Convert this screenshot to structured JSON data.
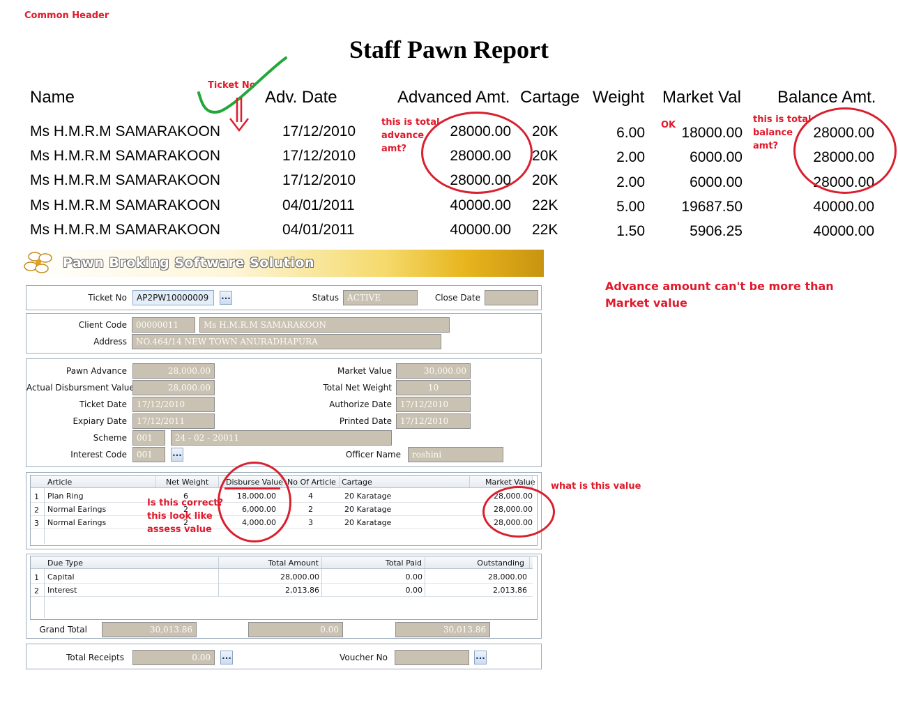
{
  "annotations": {
    "common_header": "Common Header",
    "ticket_no": "Ticket No",
    "total_advance": [
      "this is total",
      "advance",
      "amt?"
    ],
    "ok": "OK",
    "total_balance": [
      "this is total",
      "balance",
      "amt?"
    ],
    "advance_rule": [
      "Advance amount can't  be   more than",
      "Market value"
    ],
    "what_value": "what is this value",
    "assess_note": [
      "Is this correct?",
      "this look like",
      "assess value"
    ]
  },
  "report": {
    "title": "Staff Pawn Report",
    "headers": {
      "name": "Name",
      "adv_date": "Adv. Date",
      "advanced_amt": "Advanced Amt.",
      "cartage": "Cartage",
      "weight": "Weight",
      "market_val": "Market Val",
      "balance_amt": "Balance Amt."
    },
    "rows": [
      {
        "name": "Ms H.M.R.M SAMARAKOON",
        "date": "17/12/2010",
        "advanced": "28000.00",
        "cartage": "20K",
        "weight": "6.00",
        "market": "18000.00",
        "balance": "28000.00"
      },
      {
        "name": "Ms H.M.R.M SAMARAKOON",
        "date": "17/12/2010",
        "advanced": "28000.00",
        "cartage": "20K",
        "weight": "2.00",
        "market": "6000.00",
        "balance": "28000.00"
      },
      {
        "name": "Ms H.M.R.M SAMARAKOON",
        "date": "17/12/2010",
        "advanced": "28000.00",
        "cartage": "20K",
        "weight": "2.00",
        "market": "6000.00",
        "balance": "28000.00"
      },
      {
        "name": "Ms H.M.R.M SAMARAKOON",
        "date": "04/01/2011",
        "advanced": "40000.00",
        "cartage": "22K",
        "weight": "5.00",
        "market": "19687.50",
        "balance": "40000.00"
      },
      {
        "name": "Ms H.M.R.M SAMARAKOON",
        "date": "04/01/2011",
        "advanced": "40000.00",
        "cartage": "22K",
        "weight": "1.50",
        "market": "5906.25",
        "balance": "40000.00"
      }
    ]
  },
  "app": {
    "banner": "Pawn Broking Software Solution"
  },
  "ticket": {
    "ticket_no_label": "Ticket No",
    "ticket_no": "AP2PW10000009",
    "browse": "...",
    "status_label": "Status",
    "status": "ACTIVE",
    "close_date_label": "Close Date",
    "close_date": ""
  },
  "client": {
    "code_label": "Client Code",
    "code": "00000011",
    "name": "Ms H.M.R.M SAMARAKOON",
    "address_label": "Address",
    "address": "NO.464/14 NEW TOWN  ANURADHAPURA"
  },
  "pawn": {
    "advance_label": "Pawn Advance",
    "advance": "28,000.00",
    "disbursment_label": "Actual Disbursment Value",
    "disbursment": "28,000.00",
    "ticket_date_label": "Ticket Date",
    "ticket_date": "17/12/2010",
    "expiary_label": "Expiary Date",
    "expiary": "17/12/2011",
    "scheme_label": "Scheme",
    "scheme_code": "001",
    "scheme_name": "24 - 02 - 20011",
    "interest_label": "Interest Code",
    "interest_code": "001",
    "browse": "...",
    "market_value_label": "Market Value",
    "market_value": "30,000.00",
    "net_weight_label": "Total Net Weight",
    "net_weight": "10",
    "authorize_label": "Authorize Date",
    "authorize": "17/12/2010",
    "printed_label": "Printed Date",
    "printed": "17/12/2010",
    "officer_label": "Officer Name",
    "officer": "roshini"
  },
  "articles": {
    "headers": {
      "article": "Article",
      "net_weight": "Net Weight",
      "disburse": "Disburse Value",
      "no": "No Of Article",
      "cartage": "Cartage",
      "market": "Market Value"
    },
    "rows": [
      {
        "idx": "1",
        "article": "Plan Ring",
        "net_weight": "6",
        "disburse": "18,000.00",
        "no": "4",
        "cartage": "20 Karatage",
        "market": "28,000.00"
      },
      {
        "idx": "2",
        "article": "Normal Earings",
        "net_weight": "2",
        "disburse": "6,000.00",
        "no": "2",
        "cartage": "20 Karatage",
        "market": "28,000.00"
      },
      {
        "idx": "3",
        "article": "Normal Earings",
        "net_weight": "2",
        "disburse": "4,000.00",
        "no": "3",
        "cartage": "20 Karatage",
        "market": "28,000.00"
      }
    ]
  },
  "dues": {
    "headers": {
      "type": "Due Type",
      "total": "Total Amount",
      "paid": "Total Paid",
      "outstanding": "Outstanding"
    },
    "rows": [
      {
        "idx": "1",
        "type": "Capital",
        "total": "28,000.00",
        "paid": "0.00",
        "outstanding": "28,000.00"
      },
      {
        "idx": "2",
        "type": "Interest",
        "total": "2,013.86",
        "paid": "0.00",
        "outstanding": "2,013.86"
      }
    ],
    "grand_total_label": "Grand Total",
    "grand_total": "30,013.86",
    "grand_paid": "0.00",
    "grand_outstanding": "30,013.86"
  },
  "receipts": {
    "total_label": "Total Receipts",
    "total": "0.00",
    "browse": "...",
    "voucher_label": "Voucher No",
    "voucher": ""
  },
  "colors": {
    "annotation_red": "#e0192b",
    "checkmark_green": "#22a83a",
    "readonly_field": "#c9c2b3"
  }
}
